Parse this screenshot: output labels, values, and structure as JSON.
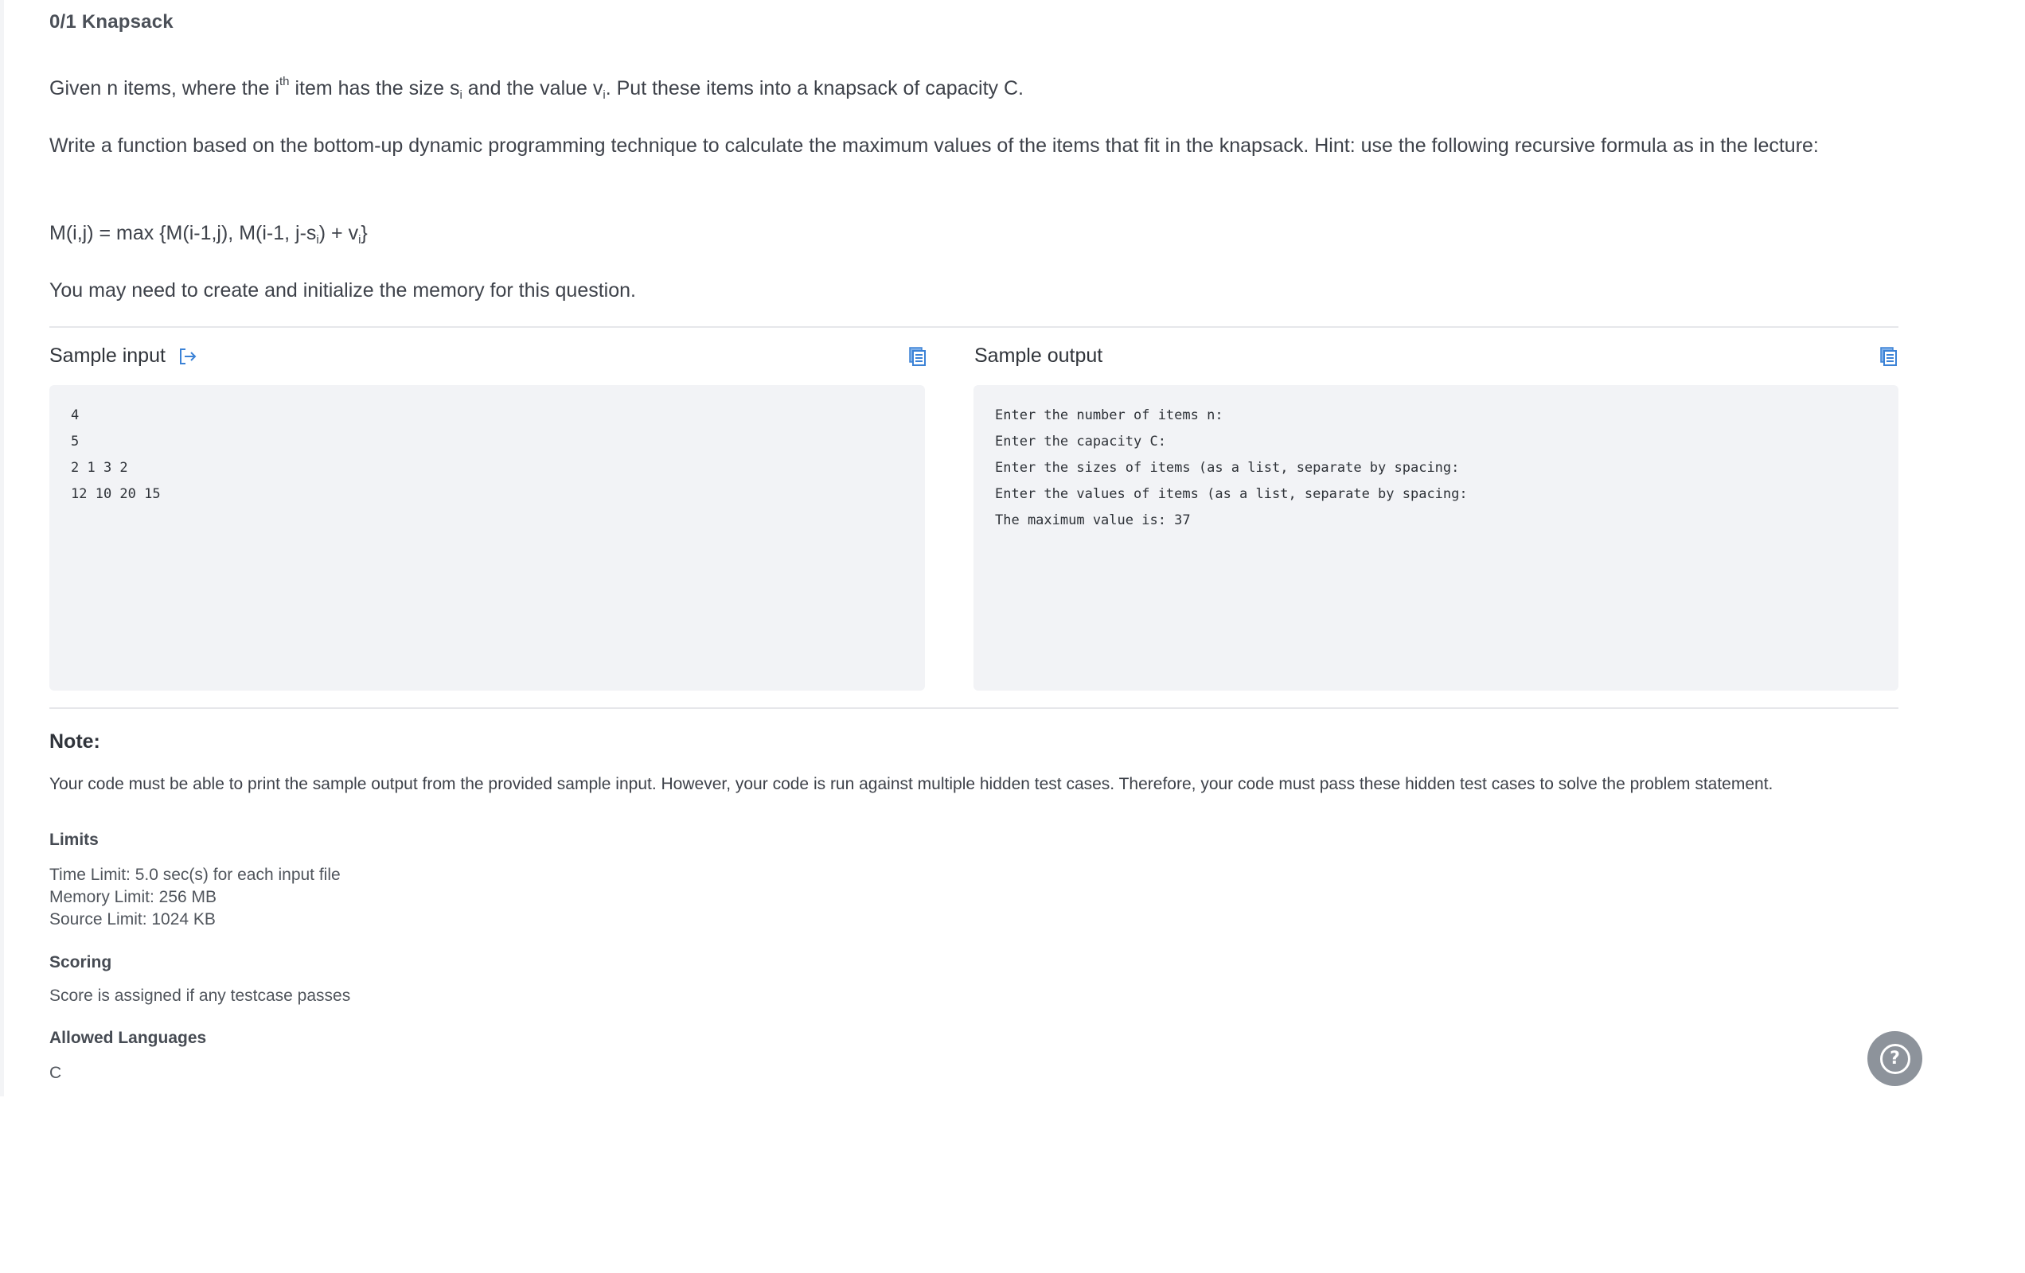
{
  "problem": {
    "title": "0/1 Knapsack",
    "p1": {
      "a": "Given n items, where the i",
      "sup": "th",
      "b": " item has the size s",
      "sub1": "i",
      "c": " and the value v",
      "sub2": "i",
      "d": ". Put these items into a knapsack of capacity C."
    },
    "p2": "Write a function based on the bottom-up dynamic programming technique to calculate the maximum values of the items that fit in the knapsack. Hint: use the following recursive formula as in the lecture:",
    "formula": {
      "a": "M(i,j) = max {M(i-1,j), M(i-1, j-s",
      "sub1": "i",
      "b": ") + v",
      "sub2": "i",
      "c": "}"
    },
    "p4": "You may need to create and initialize the memory for this question."
  },
  "sample_input": {
    "label": "Sample input",
    "icon": "open-in-editor-icon",
    "copy_icon": "copy-icon",
    "lines": [
      "4",
      "5",
      "2 1 3 2",
      "12 10 20 15"
    ]
  },
  "sample_output": {
    "label": "Sample output",
    "copy_icon": "copy-icon",
    "lines": [
      "Enter the number of items n:",
      "Enter the capacity C:",
      "Enter the sizes of items (as a list, separate by spacing:",
      "Enter the values of items (as a list, separate by spacing:",
      "The maximum value is: 37"
    ]
  },
  "note": {
    "title": "Note:",
    "text": "Your code must be able to print the sample output from the provided sample input. However, your code is run against multiple hidden test cases. Therefore, your code must pass these hidden test cases to solve the problem statement."
  },
  "limits": {
    "title": "Limits",
    "lines": [
      "Time Limit: 5.0 sec(s) for each input file",
      "Memory Limit: 256 MB",
      "Source Limit: 1024 KB"
    ]
  },
  "scoring": {
    "title": "Scoring",
    "text": "Score is assigned if any testcase passes"
  },
  "languages": {
    "title": "Allowed Languages",
    "value": "C"
  },
  "help": {
    "icon": "help-icon",
    "glyph": "?"
  },
  "colors": {
    "accent": "#3b82d6",
    "panel_bg": "#f2f3f6",
    "help_bg": "#8d939b"
  }
}
